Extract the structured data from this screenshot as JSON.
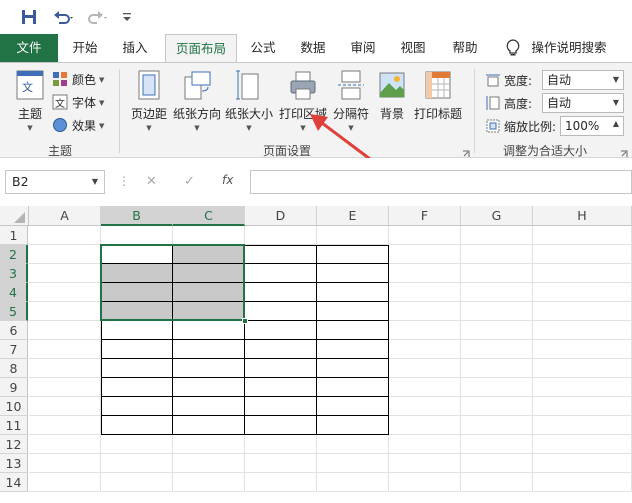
{
  "tabs": [
    {
      "label": "文件",
      "name": "tab-file"
    },
    {
      "label": "开始",
      "name": "tab-home"
    },
    {
      "label": "插入",
      "name": "tab-insert"
    },
    {
      "label": "页面布局",
      "name": "tab-page-layout"
    },
    {
      "label": "公式",
      "name": "tab-formulas"
    },
    {
      "label": "数据",
      "name": "tab-data"
    },
    {
      "label": "审阅",
      "name": "tab-review"
    },
    {
      "label": "视图",
      "name": "tab-view"
    },
    {
      "label": "帮助",
      "name": "tab-help"
    }
  ],
  "tell_me": "操作说明搜索",
  "ribbon": {
    "themes": {
      "main": "主题",
      "colors": "颜色",
      "fonts": "字体",
      "effects": "效果",
      "group": "主题"
    },
    "page_setup": {
      "margins": "页边距",
      "orientation": "纸张方向",
      "size": "纸张大小",
      "print_area": "打印区域",
      "breaks": "分隔符",
      "background": "背景",
      "print_titles": "打印标题",
      "group": "页面设置"
    },
    "scale": {
      "width_label": "宽度:",
      "width_value": "自动",
      "height_label": "高度:",
      "height_value": "自动",
      "scale_label": "缩放比例:",
      "scale_value": "100%",
      "group": "调整为合适大小"
    }
  },
  "formula_bar": {
    "name_box": "B2",
    "cancel": "✕",
    "enter": "✓",
    "fx": "fx"
  },
  "columns": [
    "A",
    "B",
    "C",
    "D",
    "E",
    "F",
    "G",
    "H"
  ],
  "rows": [
    "1",
    "2",
    "3",
    "4",
    "5",
    "6",
    "7",
    "8",
    "9",
    "10",
    "11",
    "12",
    "13",
    "14"
  ],
  "colors": {
    "accent": "#217346",
    "selection_fill": "#c8c8c8",
    "arrow": "#e0403a"
  }
}
